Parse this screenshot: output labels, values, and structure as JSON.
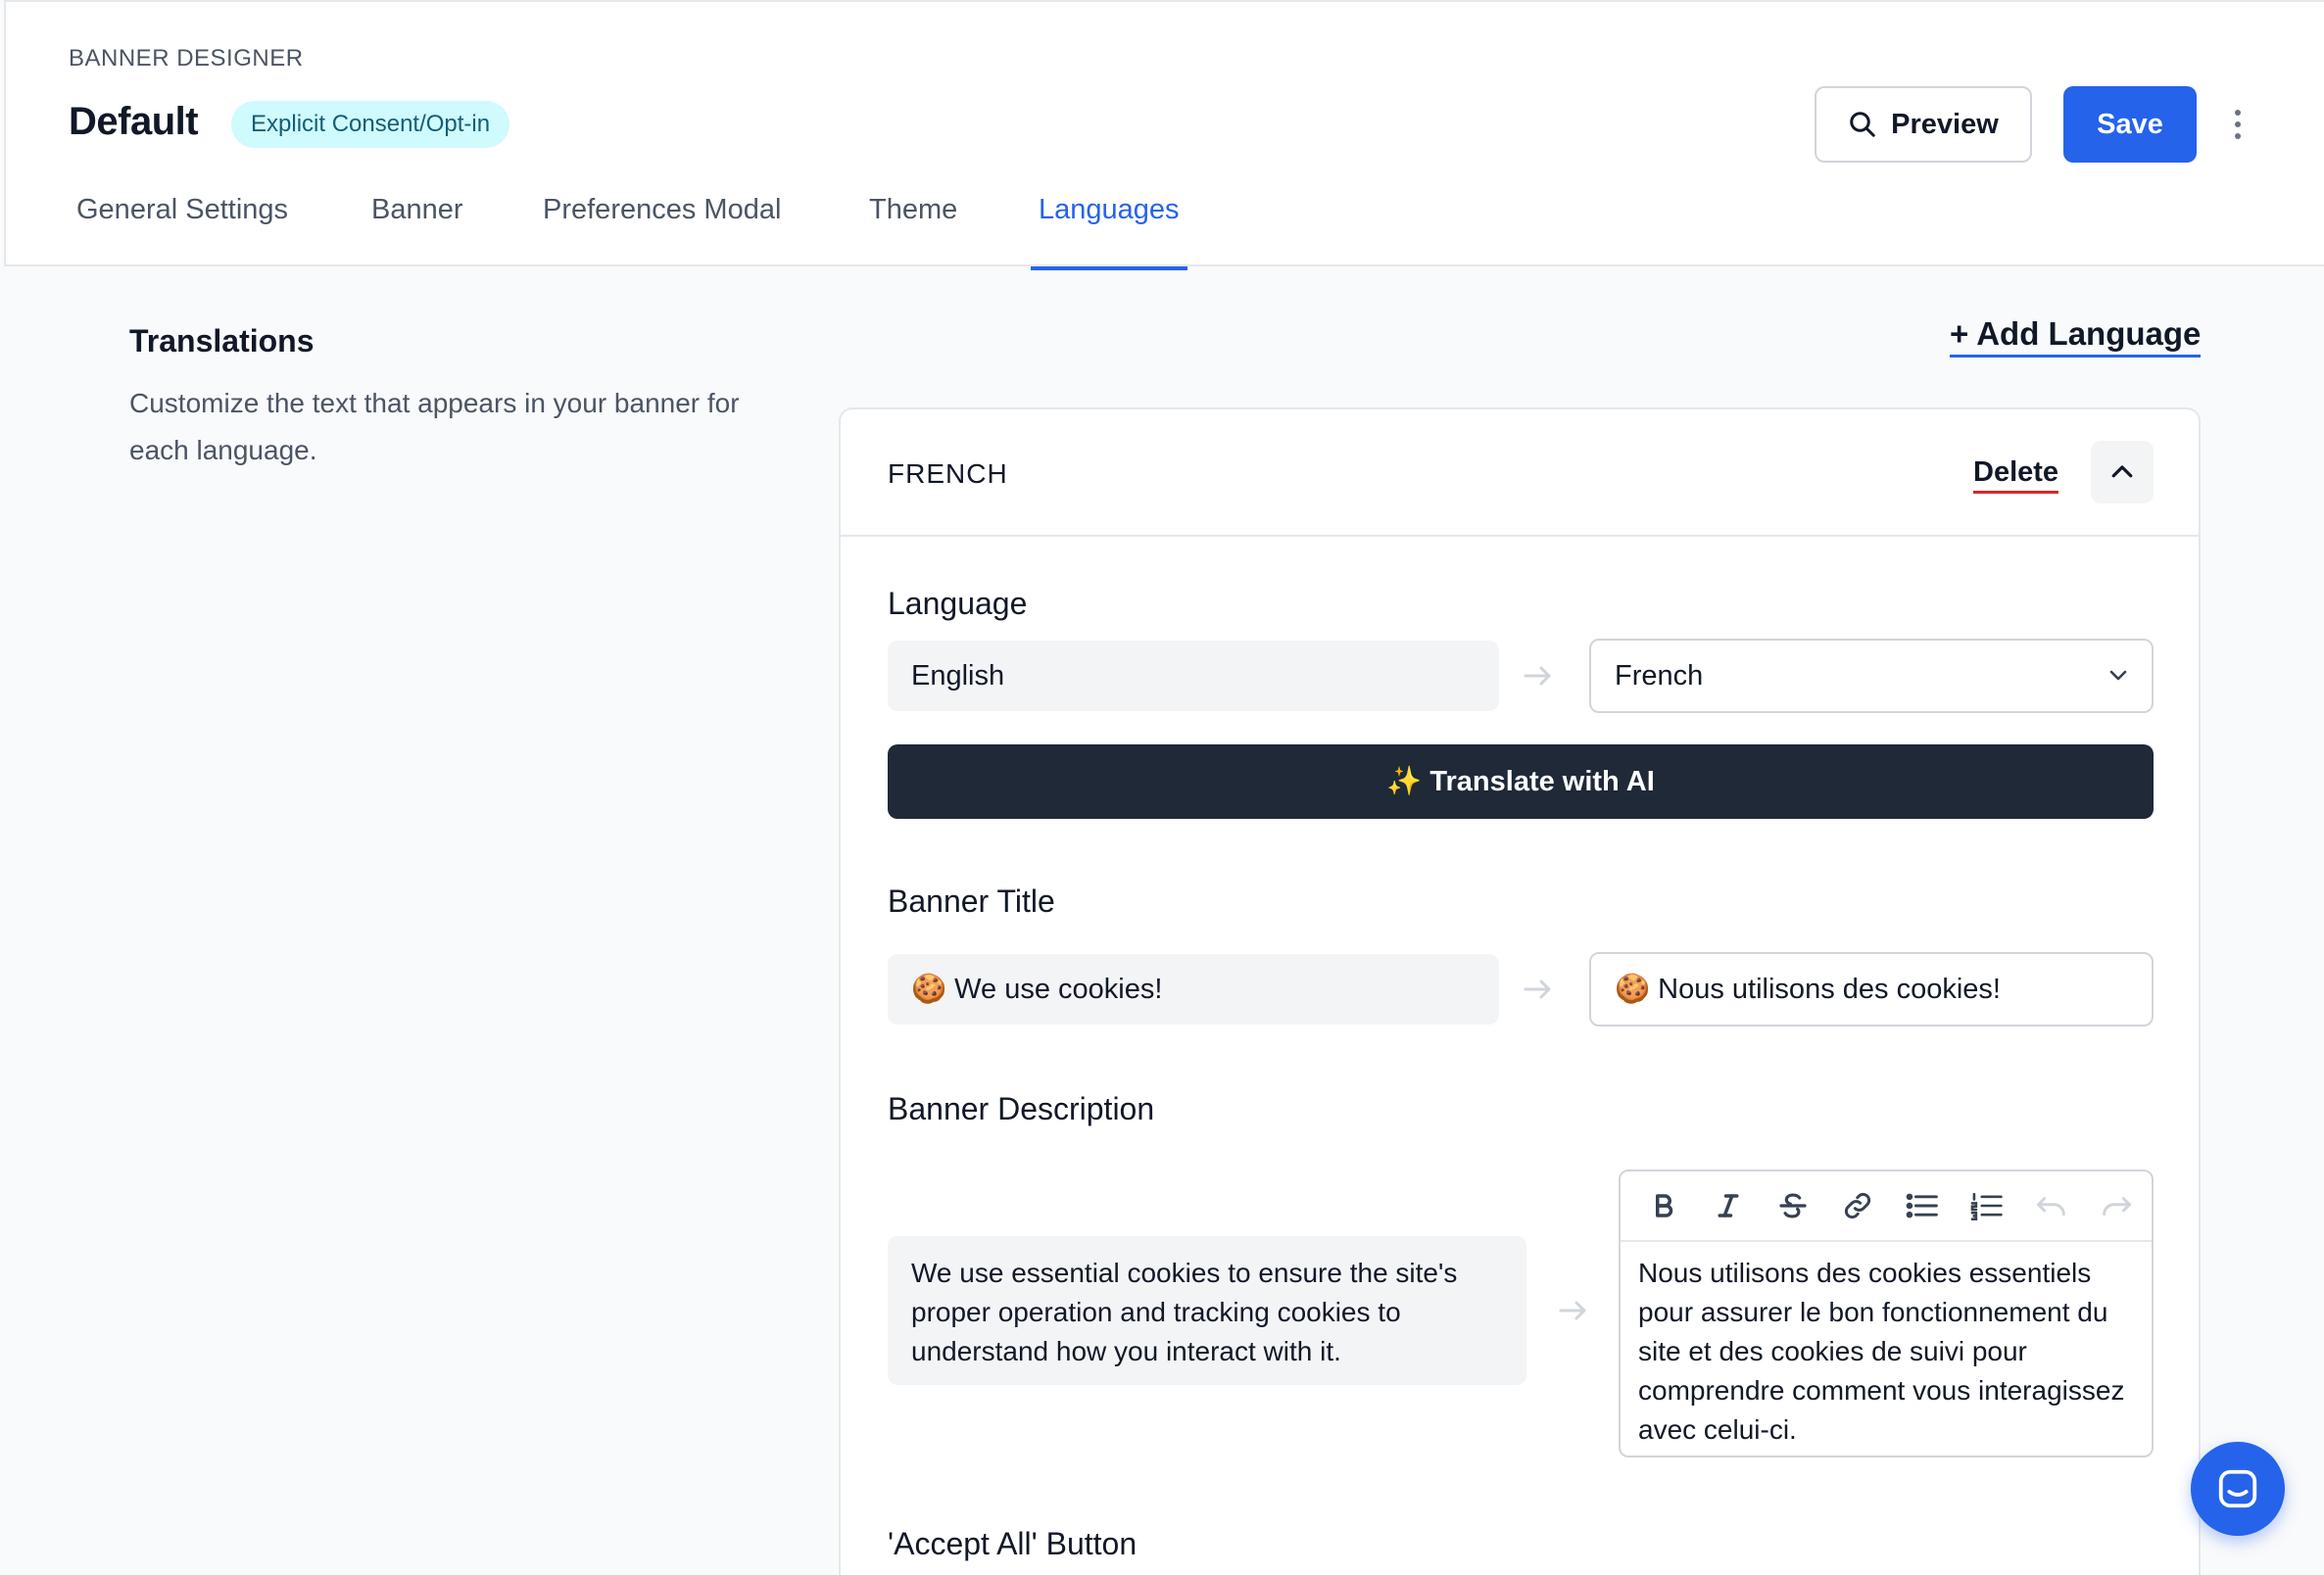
{
  "header": {
    "eyebrow": "BANNER DESIGNER",
    "title": "Default",
    "mode_badge": "Explicit Consent/Opt-in",
    "preview_label": "Preview",
    "save_label": "Save"
  },
  "tabs": [
    {
      "label": "General Settings",
      "active": false
    },
    {
      "label": "Banner",
      "active": false
    },
    {
      "label": "Preferences Modal",
      "active": false
    },
    {
      "label": "Theme",
      "active": false
    },
    {
      "label": "Languages",
      "active": true
    }
  ],
  "translations": {
    "title": "Translations",
    "description": "Customize the text that appears in your banner for each language.",
    "add_language_label": "+ Add Language"
  },
  "language_card": {
    "heading": "FRENCH",
    "delete_label": "Delete",
    "language": {
      "label": "Language",
      "source": "English",
      "target": "French"
    },
    "translate_ai_label": "✨ Translate with AI",
    "banner_title": {
      "label": "Banner Title",
      "source": "🍪 We use cookies!",
      "target": "🍪 Nous utilisons des cookies!"
    },
    "banner_description": {
      "label": "Banner Description",
      "source": "We use essential cookies to ensure the site's proper operation and tracking cookies to understand how you interact with it.",
      "target": "Nous utilisons des cookies essentiels pour assurer le bon fonctionnement du site et des cookies de suivi pour comprendre comment vous interagissez avec celui-ci."
    },
    "accept_all": {
      "label": "'Accept All' Button"
    }
  },
  "editor_toolbar": [
    "bold-icon",
    "italic-icon",
    "strikethrough-icon",
    "link-icon",
    "bullet-list-icon",
    "numbered-list-icon",
    "undo-icon",
    "redo-icon"
  ],
  "colors": {
    "accent": "#2563eb",
    "badge_bg": "#cffafe",
    "badge_text": "#155e75",
    "dark_button": "#1f2937",
    "delete_underline": "#dc2626"
  }
}
